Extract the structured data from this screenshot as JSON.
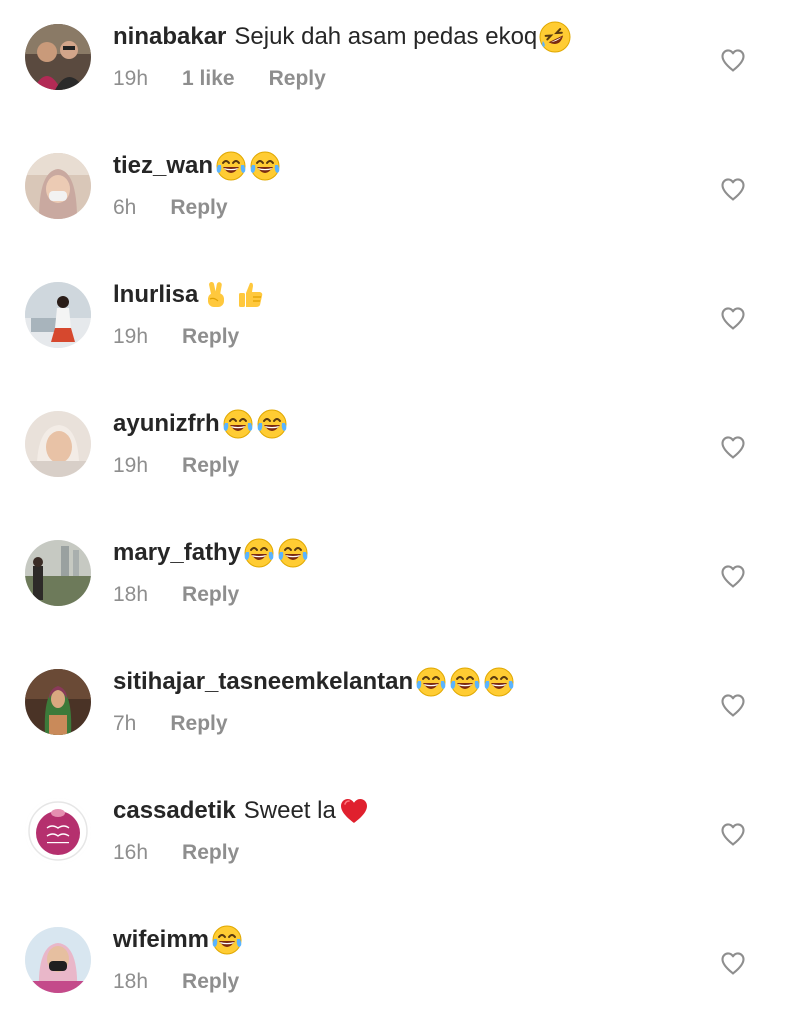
{
  "comments": [
    {
      "username": "ninabakar",
      "text": "Sejuk dah asam pedas ekoq",
      "emojis": [
        "rofl-emoji"
      ],
      "time": "19h",
      "likes": "1 like",
      "reply": "Reply"
    },
    {
      "username": "tiez_wan",
      "text": "",
      "emojis": [
        "tears-of-joy-emoji",
        "tears-of-joy-emoji"
      ],
      "time": "6h",
      "likes": "",
      "reply": "Reply"
    },
    {
      "username": "lnurlisa",
      "text": "",
      "emojis": [
        "victory-hand-emoji",
        "thumbs-up-emoji"
      ],
      "time": "19h",
      "likes": "",
      "reply": "Reply"
    },
    {
      "username": "ayunizfrh",
      "text": "",
      "emojis": [
        "tears-of-joy-emoji",
        "tears-of-joy-emoji"
      ],
      "time": "19h",
      "likes": "",
      "reply": "Reply"
    },
    {
      "username": "mary_fathy",
      "text": "",
      "emojis": [
        "tears-of-joy-emoji",
        "tears-of-joy-emoji"
      ],
      "time": "18h",
      "likes": "",
      "reply": "Reply"
    },
    {
      "username": "sitihajar_tasneemkelantan",
      "text": "",
      "emojis": [
        "tears-of-joy-emoji",
        "tears-of-joy-emoji",
        "tears-of-joy-emoji"
      ],
      "time": "7h",
      "likes": "",
      "reply": "Reply"
    },
    {
      "username": "cassadetik",
      "text": "Sweet la",
      "emojis": [
        "red-heart-emoji"
      ],
      "time": "16h",
      "likes": "",
      "reply": "Reply"
    },
    {
      "username": "wifeimm",
      "text": "",
      "emojis": [
        "tears-of-joy-emoji"
      ],
      "time": "18h",
      "likes": "",
      "reply": "Reply"
    }
  ],
  "colors": {
    "primary_text": "#262626",
    "secondary_text": "#8e8e8e",
    "heart_outline": "#8e8e8e"
  },
  "icons": {
    "like": "heart-outline-icon"
  }
}
